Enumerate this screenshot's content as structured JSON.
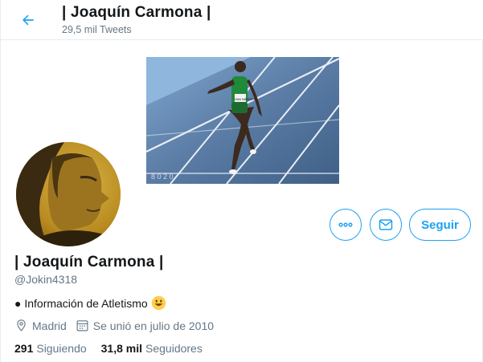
{
  "header": {
    "title": "| Joaquín Carmona |",
    "tweet_count": "29,5 mil Tweets"
  },
  "profile": {
    "name": "| Joaquín Carmona |",
    "handle": "@Jokin4318",
    "bio": "● Información de Atletismo",
    "location": "Madrid",
    "joined": "Se unió en julio de 2010",
    "following_count": "291",
    "following_label": "Siguiendo",
    "followers_count": "31,8 mil",
    "followers_label": "Seguidores"
  },
  "actions": {
    "follow_label": "Seguir",
    "more_icon": "more-icon",
    "message_icon": "mail-icon"
  },
  "banner": {
    "bib_text": "VAN NIEKERK"
  },
  "colors": {
    "accent": "#1da1f2",
    "muted": "#657786",
    "text": "#14171a",
    "border": "#e6ecf0"
  }
}
